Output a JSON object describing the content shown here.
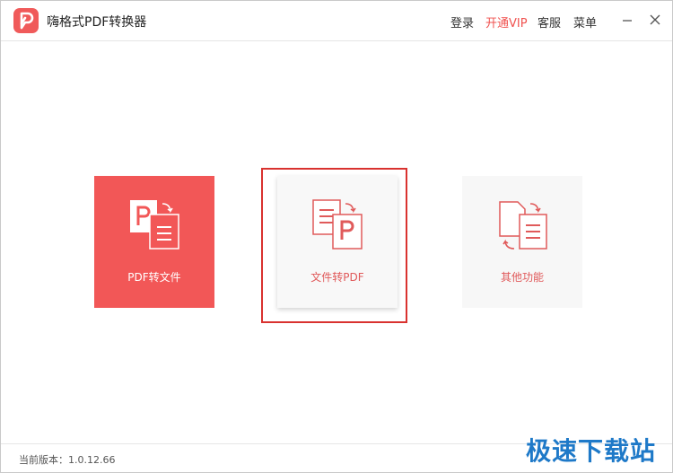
{
  "app": {
    "title": "嗨格式PDF转换器"
  },
  "nav": {
    "login": "登录",
    "vip": "开通VIP",
    "service": "客服",
    "menu": "菜单"
  },
  "cards": [
    {
      "label": "PDF转文件"
    },
    {
      "label": "文件转PDF"
    },
    {
      "label": "其他功能"
    }
  ],
  "footer": {
    "version": "当前版本：1.0.12.66",
    "watermark": "极速下载站"
  },
  "colors": {
    "accent": "#f25757",
    "highlight": "#d9322f",
    "watermark": "#1e79c8"
  }
}
